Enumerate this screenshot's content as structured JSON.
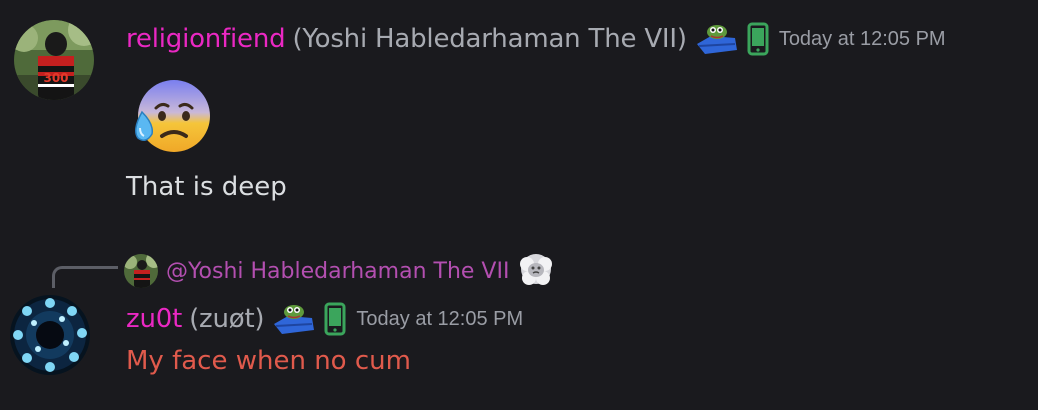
{
  "colors": {
    "background": "#1a1a1e",
    "username_pink": "#ea28c3",
    "mention_purple": "#b34fb0",
    "red_text": "#e05a4c",
    "phone_green": "#3ba55c",
    "timestamp_gray": "#9a9da5"
  },
  "messages": [
    {
      "username": "religionfiend",
      "nickname": "(Yoshi Habledarhaman The VII)",
      "badges": [
        "pepe-blanket-icon",
        "mobile-phone-icon"
      ],
      "timestamp": "Today at 12:05 PM",
      "emoji": "anxious-face-with-sweat-icon",
      "text": "That is deep"
    },
    {
      "reply": {
        "mention": "@Yoshi Habledarhaman The VII",
        "emoji": "face-in-clouds-icon"
      },
      "username": "zu0t",
      "nickname": "(zuøt)",
      "badges": [
        "pepe-blanket-icon",
        "mobile-phone-icon"
      ],
      "timestamp": "Today at 12:05 PM",
      "text": "My face when no cum"
    }
  ]
}
